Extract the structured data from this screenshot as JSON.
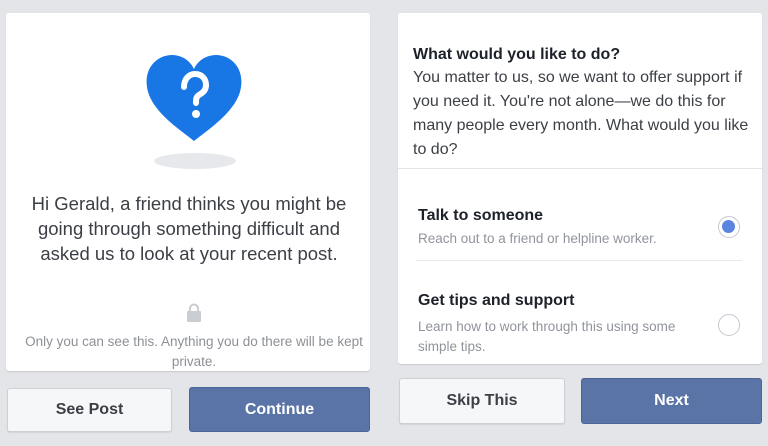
{
  "left_panel": {
    "heart_icon": "heart-question-icon",
    "message": "Hi Gerald, a friend thinks you might be going through something difficult and asked us to look at your recent post.",
    "lock_icon": "lock-icon",
    "privacy_note": "Only you can see this. Anything you do there will be kept private."
  },
  "right_panel": {
    "title": "What would you like to do?",
    "body": "You matter to us, so we want to offer support if you need it. You're not alone—we do this for many people every month. What would you like to do?",
    "options": [
      {
        "title": "Talk to someone",
        "description": "Reach out to a friend or helpline worker.",
        "selected": true
      },
      {
        "title": "Get tips and support",
        "description": "Learn how to work through this using some simple tips.",
        "selected": false
      }
    ]
  },
  "buttons": {
    "see_post": "See Post",
    "continue": "Continue",
    "skip": "Skip This",
    "next": "Next"
  },
  "colors": {
    "brand_blue": "#5a74a8",
    "heart_blue": "#1877e5",
    "radio_selected": "#5a84e0",
    "background": "#e4e5e9"
  }
}
